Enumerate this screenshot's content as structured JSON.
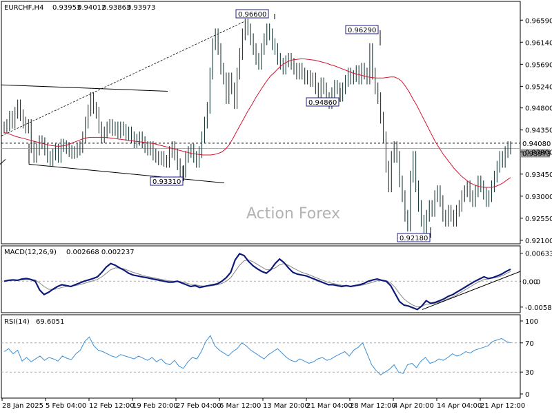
{
  "chart_data": [
    {
      "type": "line",
      "symbol_label": "EURCHF,H4",
      "ohlc": {
        "open": "0.93953",
        "high": "0.94012",
        "low": "0.93863",
        "close": "0.93973"
      },
      "watermark": "Action Forex",
      "ylim": [
        0.9207,
        0.9672
      ],
      "y_ticks": [
        "0.96590",
        "0.96140",
        "0.95690",
        "0.95240",
        "0.94800",
        "0.94350",
        "0.93900",
        "0.93450",
        "0.93000",
        "0.92550",
        "0.92100"
      ],
      "x_ticks": [
        "28 Jan 2025",
        "5 Feb 04:00",
        "12 Feb 12:00",
        "19 Feb 20:00",
        "27 Feb 04:00",
        "6 Mar 12:00",
        "13 Mar 20:00",
        "21 Mar 04:00",
        "28 Mar 12:00",
        "4 Apr 20:00",
        "14 Apr 04:00",
        "21 Apr 12:00"
      ],
      "price_tags": [
        {
          "label": "0.94080",
          "value": 0.9408,
          "style": "dotted"
        },
        {
          "label": "0.93973",
          "value": 0.93973,
          "style": "solid"
        }
      ],
      "annotations": [
        {
          "label": "0.96600",
          "bar": 89,
          "value": 0.966
        },
        {
          "label": "0.96290",
          "bar": 135,
          "value": 0.9629
        },
        {
          "label": "0.94860",
          "bar": 120,
          "value": 0.9486
        },
        {
          "label": "0.93310",
          "bar": 65,
          "value": 0.9331
        },
        {
          "label": "0.92180",
          "bar": 154,
          "value": 0.9218
        }
      ],
      "price_series": [
        0.944,
        0.9445,
        0.9462,
        0.945,
        0.947,
        0.9485,
        0.9465,
        0.945,
        0.944,
        0.9445,
        0.94,
        0.938,
        0.9395,
        0.9412,
        0.9408,
        0.9395,
        0.938,
        0.9372,
        0.9385,
        0.9395,
        0.938,
        0.9405,
        0.9402,
        0.9398,
        0.9392,
        0.9388,
        0.939,
        0.9395,
        0.94,
        0.942,
        0.945,
        0.9475,
        0.95,
        0.948,
        0.947,
        0.944,
        0.942,
        0.943,
        0.944,
        0.9445,
        0.9435,
        0.944,
        0.943,
        0.944,
        0.9435,
        0.9425,
        0.943,
        0.942,
        0.941,
        0.9415,
        0.942,
        0.941,
        0.94,
        0.9395,
        0.94,
        0.9385,
        0.938,
        0.9375,
        0.938,
        0.9372,
        0.937,
        0.939,
        0.94,
        0.9385,
        0.9365,
        0.934,
        0.935,
        0.938,
        0.939,
        0.9395,
        0.938,
        0.937,
        0.939,
        0.942,
        0.945,
        0.948,
        0.955,
        0.961,
        0.963,
        0.96,
        0.956,
        0.954,
        0.95,
        0.954,
        0.952,
        0.949,
        0.955,
        0.959,
        0.963,
        0.965,
        0.964,
        0.962,
        0.96,
        0.958,
        0.957,
        0.96,
        0.962,
        0.964,
        0.963,
        0.961,
        0.96,
        0.958,
        0.957,
        0.956,
        0.9575,
        0.958,
        0.957,
        0.956,
        0.955,
        0.956,
        0.955,
        0.954,
        0.9545,
        0.9535,
        0.954,
        0.952,
        0.951,
        0.953,
        0.952,
        0.95,
        0.949,
        0.951,
        0.9525,
        0.952,
        0.9505,
        0.952,
        0.9535,
        0.955,
        0.954,
        0.9545,
        0.9555,
        0.954,
        0.956,
        0.955,
        0.954,
        0.96,
        0.955,
        0.952,
        0.95,
        0.946,
        0.942,
        0.936,
        0.932,
        0.938,
        0.94,
        0.938,
        0.933,
        0.93,
        0.926,
        0.924,
        0.934,
        0.938,
        0.932,
        0.928,
        0.925,
        0.923,
        0.926,
        0.928,
        0.927,
        0.93,
        0.931,
        0.929,
        0.926,
        0.925,
        0.927,
        0.926,
        0.925,
        0.927,
        0.928,
        0.93,
        0.931,
        0.932,
        0.93,
        0.929,
        0.931,
        0.933,
        0.932,
        0.9305,
        0.929,
        0.93,
        0.932,
        0.934,
        0.936,
        0.938,
        0.937,
        0.939,
        0.94,
        0.9397
      ],
      "moving_average": [
        0.943,
        0.9428,
        0.9425,
        0.9422,
        0.942,
        0.9418,
        0.9416,
        0.9414,
        0.9412,
        0.941,
        0.9408,
        0.9406,
        0.9404,
        0.9403,
        0.9402,
        0.9402,
        0.9403,
        0.9405,
        0.9408,
        0.9411,
        0.9414,
        0.9417,
        0.9419,
        0.942,
        0.942,
        0.942,
        0.942,
        0.942,
        0.9419,
        0.9418,
        0.9417,
        0.9416,
        0.9415,
        0.9414,
        0.9413,
        0.9412,
        0.9411,
        0.941,
        0.9409,
        0.9408,
        0.9407,
        0.9405,
        0.9403,
        0.9401,
        0.9399,
        0.9397,
        0.9395,
        0.9393,
        0.9391,
        0.9389,
        0.9387,
        0.9386,
        0.9385,
        0.9384,
        0.9384,
        0.9384,
        0.9385,
        0.9387,
        0.939,
        0.9396,
        0.9405,
        0.9418,
        0.9432,
        0.9446,
        0.946,
        0.9474,
        0.9486,
        0.95,
        0.9512,
        0.9524,
        0.9535,
        0.9545,
        0.9552,
        0.956,
        0.9567,
        0.9572,
        0.9576,
        0.9578,
        0.9579,
        0.958,
        0.958,
        0.9579,
        0.9578,
        0.9577,
        0.9575,
        0.9573,
        0.9571,
        0.9568,
        0.9566,
        0.9563,
        0.956,
        0.9557,
        0.9554,
        0.9551,
        0.9549,
        0.9547,
        0.9545,
        0.9543,
        0.9542,
        0.9541,
        0.9541,
        0.9541,
        0.9542,
        0.9543,
        0.9543,
        0.954,
        0.9534,
        0.9524,
        0.9512,
        0.9498,
        0.9485,
        0.947,
        0.9455,
        0.944,
        0.9425,
        0.941,
        0.9398,
        0.9386,
        0.9376,
        0.9366,
        0.9356,
        0.9348,
        0.934,
        0.9334,
        0.9328,
        0.9324,
        0.9321,
        0.9319,
        0.9318,
        0.9318,
        0.9318,
        0.932,
        0.9323,
        0.9327,
        0.9333,
        0.9338
      ],
      "ma_start_bar": 54
    },
    {
      "type": "line",
      "title": "MACD(12,26,9)",
      "values_label": "0.002668 0.002237",
      "ylim": [
        -0.0068,
        0.0072
      ],
      "y_ticks": [
        "0.006332",
        "0.00",
        "-0.005845"
      ],
      "zero_label": "0.00",
      "main": [
        0.0,
        0.0002,
        0.0003,
        0.0002,
        0.0005,
        0.0006,
        0.0004,
        0.0,
        -0.002,
        -0.003,
        -0.0025,
        -0.0018,
        -0.0012,
        -0.0008,
        -0.001,
        -0.0012,
        -0.0008,
        -0.0004,
        0.0,
        0.0003,
        0.0006,
        0.001,
        0.002,
        0.0032,
        0.004,
        0.0036,
        0.003,
        0.0025,
        0.0018,
        0.0014,
        0.0012,
        0.001,
        0.0008,
        0.0006,
        0.0004,
        0.0002,
        0.0,
        -0.0002,
        -0.0002,
        0.0,
        -0.0004,
        -0.0008,
        -0.0012,
        -0.001,
        -0.0014,
        -0.0012,
        -0.001,
        -0.0008,
        -0.0006,
        0.0,
        0.0008,
        0.002,
        0.0048,
        0.0062,
        0.0058,
        0.0045,
        0.0035,
        0.0028,
        0.0022,
        0.0018,
        0.0026,
        0.004,
        0.005,
        0.0042,
        0.003,
        0.002,
        0.0016,
        0.0014,
        0.0012,
        0.0008,
        0.0004,
        0.0,
        -0.0004,
        -0.0008,
        -0.0008,
        -0.001,
        -0.0012,
        -0.001,
        -0.0012,
        -0.001,
        -0.0008,
        -0.0005,
        0.0,
        0.0003,
        0.0005,
        0.0002,
        0.0,
        -0.001,
        -0.0028,
        -0.0046,
        -0.0054,
        -0.0056,
        -0.006,
        -0.0064,
        -0.0056,
        -0.0044,
        -0.005,
        -0.0048,
        -0.0044,
        -0.004,
        -0.0034,
        -0.003,
        -0.0024,
        -0.0018,
        -0.0012,
        -0.0006,
        0.0,
        0.0005,
        0.001,
        0.0006,
        0.0008,
        0.0012,
        0.0016,
        0.0022,
        0.0027
      ],
      "signal": [
        0.0,
        0.0001,
        0.0002,
        0.0002,
        0.0003,
        0.0004,
        0.0004,
        0.0003,
        -0.0004,
        -0.0012,
        -0.0018,
        -0.0019,
        -0.0017,
        -0.0014,
        -0.0012,
        -0.0011,
        -0.001,
        -0.0008,
        -0.0005,
        -0.0002,
        0.0001,
        0.0004,
        0.001,
        0.0018,
        0.0026,
        0.003,
        0.003,
        0.0028,
        0.0024,
        0.002,
        0.0017,
        0.0014,
        0.0011,
        0.0009,
        0.0007,
        0.0005,
        0.0003,
        0.0001,
        0.0,
        0.0,
        -0.0002,
        -0.0004,
        -0.0007,
        -0.0008,
        -0.001,
        -0.0011,
        -0.0011,
        -0.001,
        -0.0008,
        -0.0005,
        0.0,
        0.0008,
        0.0022,
        0.0036,
        0.0046,
        0.0048,
        0.0044,
        0.0038,
        0.0032,
        0.0026,
        0.0026,
        0.003,
        0.0037,
        0.004,
        0.0036,
        0.003,
        0.0025,
        0.002,
        0.0017,
        0.0013,
        0.0009,
        0.0005,
        0.0001,
        -0.0003,
        -0.0005,
        -0.0007,
        -0.0009,
        -0.001,
        -0.0011,
        -0.0011,
        -0.001,
        -0.0008,
        -0.0005,
        -0.0002,
        0.0001,
        0.0002,
        0.0001,
        -0.0004,
        -0.0014,
        -0.0028,
        -0.004,
        -0.0048,
        -0.0054,
        -0.0058,
        -0.0057,
        -0.0052,
        -0.0051,
        -0.005,
        -0.0047,
        -0.0044,
        -0.0039,
        -0.0035,
        -0.003,
        -0.0024,
        -0.0018,
        -0.0012,
        -0.0006,
        -0.0001,
        0.0004,
        0.0005,
        0.0007,
        0.0009,
        0.0012,
        0.0017,
        0.0022
      ]
    },
    {
      "type": "line",
      "title": "RSI(14)",
      "values_label": "69.6051",
      "ylim": [
        0,
        100
      ],
      "y_ticks": [
        "100",
        "70",
        "30",
        "0"
      ],
      "levels": [
        70,
        30
      ],
      "values": [
        58,
        62,
        55,
        60,
        45,
        50,
        44,
        48,
        52,
        46,
        50,
        48,
        45,
        52,
        49,
        47,
        55,
        60,
        72,
        78,
        66,
        60,
        58,
        55,
        52,
        50,
        54,
        52,
        50,
        48,
        52,
        49,
        46,
        50,
        44,
        48,
        42,
        40,
        46,
        38,
        35,
        44,
        50,
        48,
        58,
        72,
        80,
        66,
        60,
        56,
        52,
        58,
        62,
        70,
        66,
        60,
        56,
        52,
        48,
        54,
        58,
        62,
        56,
        50,
        46,
        44,
        48,
        45,
        42,
        44,
        48,
        50,
        46,
        48,
        52,
        55,
        58,
        52,
        60,
        64,
        70,
        55,
        40,
        32,
        26,
        30,
        34,
        40,
        30,
        28,
        40,
        42,
        36,
        45,
        50,
        42,
        44,
        48,
        46,
        50,
        55,
        52,
        54,
        58,
        56,
        60,
        62,
        64,
        66,
        72,
        74,
        76,
        72,
        70
      ]
    }
  ]
}
